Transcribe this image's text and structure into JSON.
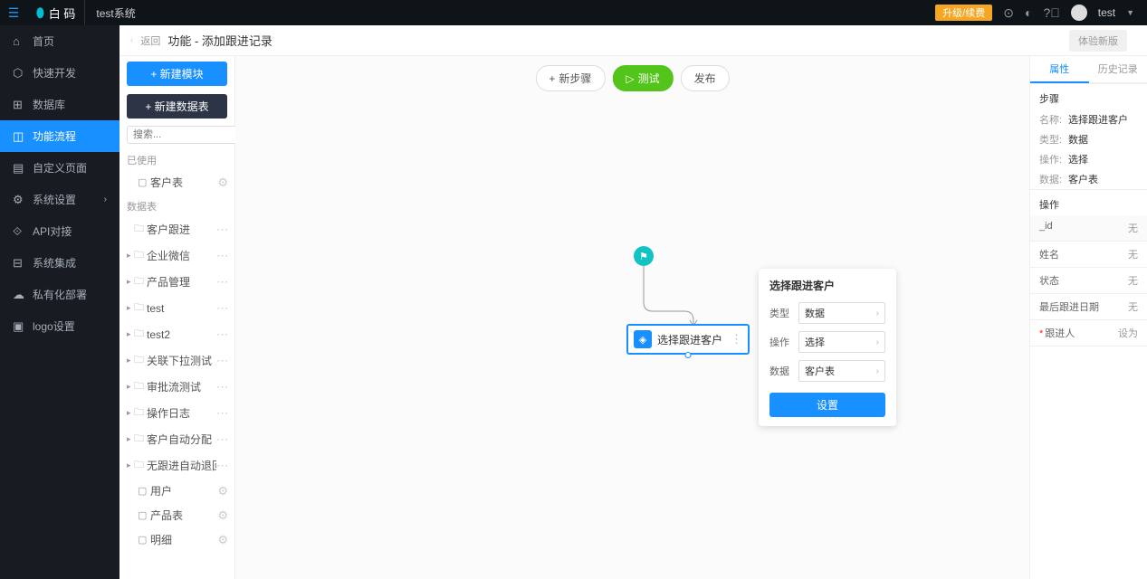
{
  "topbar": {
    "logo_text": "白 码",
    "system_name": "test系统",
    "upgrade": "升级/续费",
    "user": "test"
  },
  "breadcrumb": {
    "back": "返回",
    "title": "功能 - 添加跟进记录",
    "try_new": "体验新版"
  },
  "leftnav": [
    {
      "label": "首页",
      "icon": "⌂"
    },
    {
      "label": "快速开发",
      "icon": "⬡"
    },
    {
      "label": "数据库",
      "icon": "⊞"
    },
    {
      "label": "功能流程",
      "icon": "◫",
      "active": true
    },
    {
      "label": "自定义页面",
      "icon": "▤"
    },
    {
      "label": "系统设置",
      "icon": "⚙",
      "arrow": true
    },
    {
      "label": "API对接",
      "icon": "⟐"
    },
    {
      "label": "系统集成",
      "icon": "⊟"
    },
    {
      "label": "私有化部署",
      "icon": "☁"
    },
    {
      "label": "logo设置",
      "icon": "▣"
    }
  ],
  "tree": {
    "btn1": "新建模块",
    "btn2": "新建数据表",
    "search_placeholder": "搜索...",
    "sec1": "已使用",
    "used": [
      {
        "label": "客户表",
        "icon": "▢"
      }
    ],
    "sec2": "数据表",
    "tables": [
      {
        "label": "客户跟进",
        "exp": "",
        "icon": "🗀"
      },
      {
        "label": "企业微信",
        "exp": "▸",
        "icon": "🗀"
      },
      {
        "label": "产品管理",
        "exp": "▸",
        "icon": "🗀"
      },
      {
        "label": "test",
        "exp": "▸",
        "icon": "🗀"
      },
      {
        "label": "test2",
        "exp": "▸",
        "icon": "🗀"
      },
      {
        "label": "关联下拉测试",
        "exp": "▸",
        "icon": "🗀"
      },
      {
        "label": "审批流测试",
        "exp": "▸",
        "icon": "🗀"
      },
      {
        "label": "操作日志",
        "exp": "▸",
        "icon": "🗀"
      },
      {
        "label": "客户自动分配",
        "exp": "▸",
        "icon": "🗀"
      },
      {
        "label": "无跟进自动退回",
        "exp": "▸",
        "icon": "🗀"
      }
    ],
    "leaves": [
      {
        "label": "用户",
        "icon": "▢"
      },
      {
        "label": "产品表",
        "icon": "▢"
      },
      {
        "label": "明细",
        "icon": "▢"
      }
    ]
  },
  "canvas": {
    "new_step": "新步骤",
    "test": "测试",
    "publish": "发布",
    "node_title": "选择跟进客户"
  },
  "popup": {
    "title": "选择跟进客户",
    "rows": [
      {
        "label": "类型",
        "value": "数据"
      },
      {
        "label": "操作",
        "value": "选择"
      },
      {
        "label": "数据",
        "value": "客户表"
      }
    ],
    "btn": "设置"
  },
  "rightpanel": {
    "tab1": "属性",
    "tab2": "历史记录",
    "step_section": "步骤",
    "kv": [
      {
        "k": "名称:",
        "v": "选择跟进客户"
      },
      {
        "k": "类型:",
        "v": "数据"
      },
      {
        "k": "操作:",
        "v": "选择"
      },
      {
        "k": "数据:",
        "v": "客户表"
      }
    ],
    "op_section": "操作",
    "op_rows": [
      {
        "k": "_id",
        "v": "无",
        "head": true
      },
      {
        "k": "姓名",
        "v": "无"
      },
      {
        "k": "状态",
        "v": "无"
      },
      {
        "k": "最后跟进日期",
        "v": "无"
      },
      {
        "k": "跟进人",
        "v": "设为",
        "req": true
      }
    ]
  }
}
